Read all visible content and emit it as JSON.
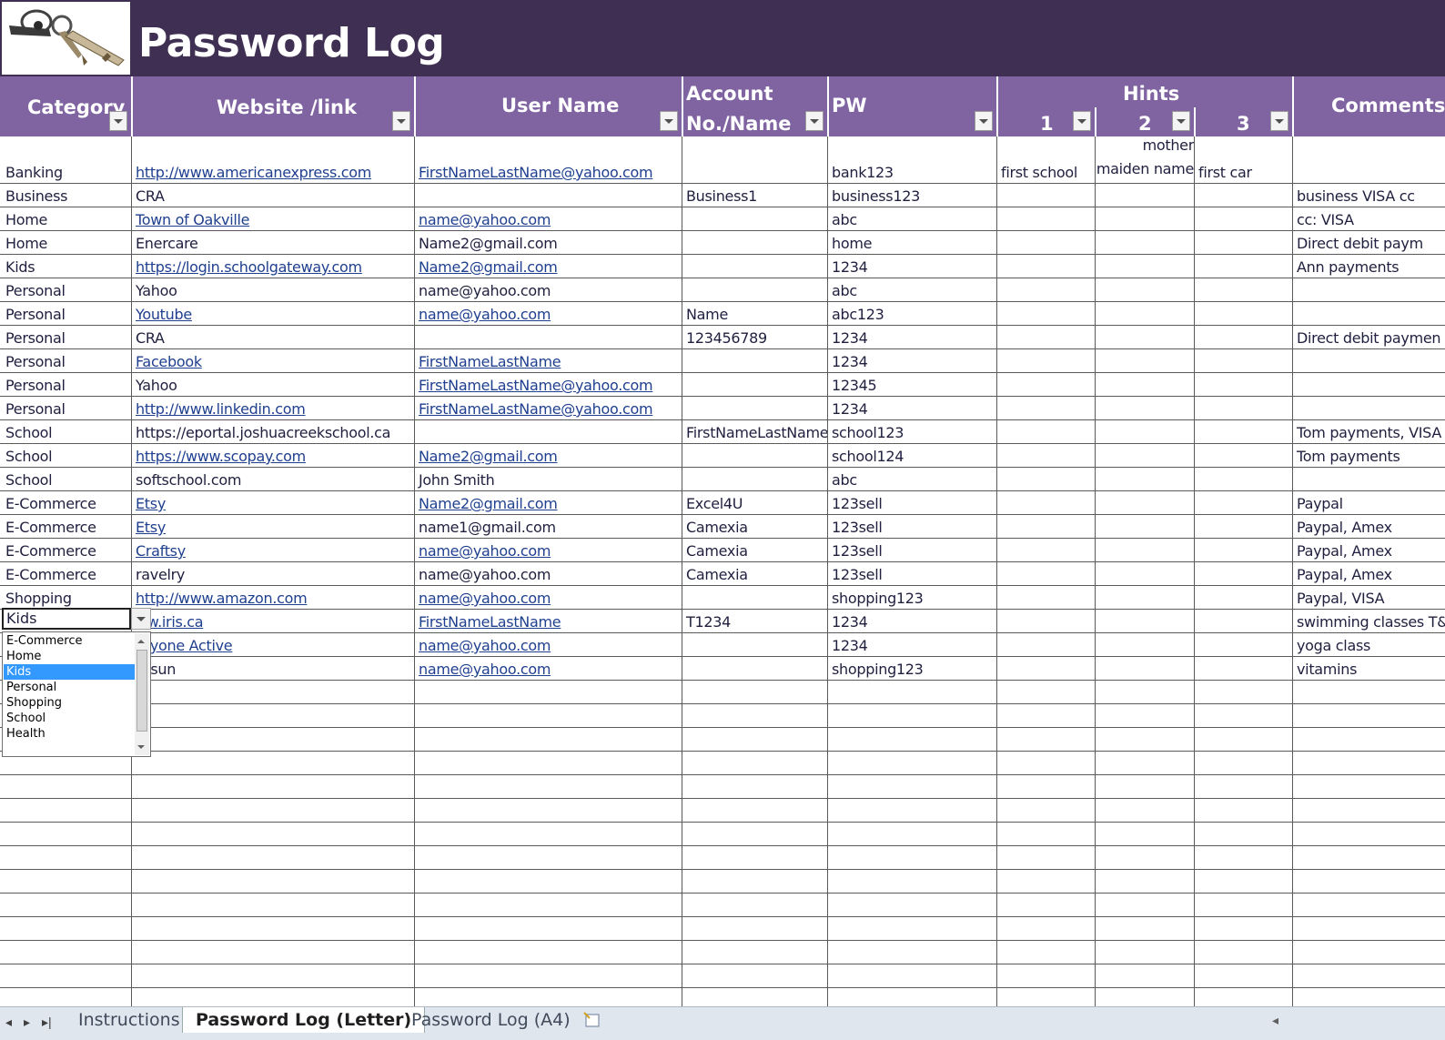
{
  "title": "Password Log",
  "logo": {
    "icon": "keys-icon"
  },
  "headers": {
    "category": "Category",
    "website": "Website /link",
    "username": "User Name",
    "account_line1": "Account",
    "account_line2": "No./Name",
    "pw": "PW",
    "hints": "Hints",
    "hint1": "1",
    "hint2": "2",
    "hint3": "3",
    "comments": "Comments"
  },
  "rows": [
    {
      "category": "Banking",
      "website": "http://www.americanexpress.com",
      "username": "FirstNameLastName@yahoo.com",
      "account": "",
      "pw": "bank123",
      "hint1": "first school",
      "hint2a": "mother",
      "hint2b": "maiden name",
      "hint3": "first car",
      "comments": ""
    },
    {
      "category": "Business",
      "website": "CRA",
      "username": "",
      "account": "Business1",
      "pw": "business123",
      "hint1": "",
      "hint2b": "",
      "hint3": "",
      "comments": "business VISA cc"
    },
    {
      "category": "Home",
      "website": "Town of Oakville",
      "username": "name@yahoo.com",
      "account": "",
      "pw": "abc",
      "comments": "cc: VISA"
    },
    {
      "category": "Home",
      "website": "Enercare",
      "username": "Name2@gmail.com",
      "account": "",
      "pw": "home",
      "comments": "Direct debit paym"
    },
    {
      "category": "Kids",
      "website": "https://login.schoolgateway.com",
      "username": "Name2@gmail.com",
      "account": "",
      "pw": "1234",
      "comments": "Ann payments"
    },
    {
      "category": "Personal",
      "website": "Yahoo",
      "username": "name@yahoo.com",
      "account": "",
      "pw": "abc",
      "comments": ""
    },
    {
      "category": "Personal",
      "website": "Youtube",
      "username": "name@yahoo.com",
      "account": "Name",
      "pw": "abc123",
      "comments": ""
    },
    {
      "category": "Personal",
      "website": "CRA",
      "username": "",
      "account": "123456789",
      "pw": "1234",
      "comments": "Direct debit paymen"
    },
    {
      "category": "Personal",
      "website": "Facebook",
      "username": "FirstNameLastName",
      "account": "",
      "pw": "1234",
      "comments": ""
    },
    {
      "category": "Personal",
      "website": "Yahoo",
      "username": "FirstNameLastName@yahoo.com",
      "account": "",
      "pw": "12345",
      "comments": ""
    },
    {
      "category": "Personal",
      "website": "http://www.linkedin.com",
      "username": "FirstNameLastName@yahoo.com",
      "account": "",
      "pw": "1234",
      "comments": ""
    },
    {
      "category": "School",
      "website": "https://eportal.joshuacreekschool.ca",
      "username": "",
      "account": "FirstNameLastName",
      "pw": "school123",
      "comments": "Tom payments, VISA"
    },
    {
      "category": "School",
      "website": "https://www.scopay.com",
      "username": "Name2@gmail.com",
      "account": "",
      "pw": "school124",
      "comments": "Tom payments"
    },
    {
      "category": "School",
      "website": "softschool.com",
      "username": "John Smith",
      "account": "",
      "pw": "abc",
      "comments": ""
    },
    {
      "category": "E-Commerce",
      "website": "Etsy",
      "username": "Name2@gmail.com",
      "account": "Excel4U",
      "pw": "123sell",
      "comments": "Paypal"
    },
    {
      "category": "E-Commerce",
      "website": "Etsy",
      "username": "name1@gmail.com",
      "account": "Camexia",
      "pw": "123sell",
      "comments": "Paypal, Amex"
    },
    {
      "category": "E-Commerce",
      "website": "Craftsy",
      "username": "name@yahoo.com",
      "account": "Camexia",
      "pw": "123sell",
      "comments": "Paypal, Amex"
    },
    {
      "category": "E-Commerce",
      "website": "ravelry",
      "username": "name@yahoo.com",
      "account": "Camexia",
      "pw": "123sell",
      "comments": "Paypal, Amex"
    },
    {
      "category": "Shopping",
      "website": "http://www.amazon.com",
      "username": "name@yahoo.com",
      "account": "",
      "pw": "shopping123",
      "comments": "Paypal, VISA"
    },
    {
      "category": "Kids",
      "website": "ww.iris.ca",
      "username": "FirstNameLastName",
      "account": "T1234",
      "pw": "1234",
      "comments": "swimming classes T&"
    },
    {
      "category": "",
      "website": "eryone Active",
      "username": "name@yahoo.com",
      "account": "",
      "pw": "1234",
      "comments": "yoga class"
    },
    {
      "category": "",
      "website": "trisun",
      "username": "name@yahoo.com",
      "account": "",
      "pw": "shopping123",
      "comments": "vitamins"
    }
  ],
  "dropdown": {
    "current": "Kids",
    "options": [
      "E-Commerce",
      "Home",
      "Kids",
      "Personal",
      "Shopping",
      "School",
      "Health"
    ],
    "selected": "Kids"
  },
  "sheet_tabs": [
    "Instructions",
    "Password Log (Letter)",
    "Password Log (A4)"
  ],
  "active_tab": "Password Log (Letter)"
}
